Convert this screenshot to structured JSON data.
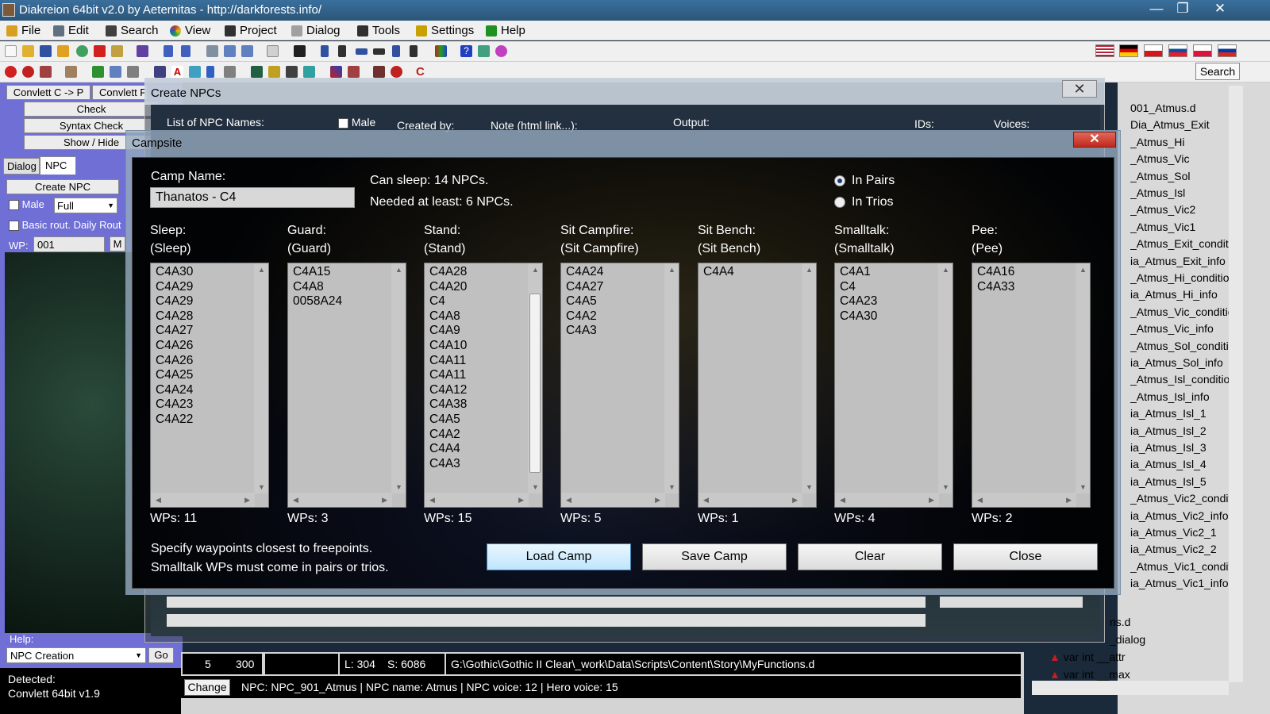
{
  "app": {
    "title": "Diakreion 64bit v2.0 by Aeternitas - http://darkforests.info/",
    "window_controls": {
      "minimize": "—",
      "maximize": "❐",
      "close": "✕"
    }
  },
  "menu": [
    {
      "label": "File",
      "icon": "folder-icon",
      "color": "#d8a020"
    },
    {
      "label": "Edit",
      "icon": "tools-icon",
      "color": "#607080"
    },
    {
      "label": "Search",
      "icon": "search-icon",
      "color": "#404040"
    },
    {
      "label": "View",
      "icon": "color-wheel-icon",
      "color": "#c04020"
    },
    {
      "label": "Project",
      "icon": "project-icon",
      "color": "#303030"
    },
    {
      "label": "Dialog",
      "icon": "dialog-icon",
      "color": "#a0a0a0"
    },
    {
      "label": "Tools",
      "icon": "flask-icon",
      "color": "#303030"
    },
    {
      "label": "Settings",
      "icon": "settings-icon",
      "color": "#c8a000"
    },
    {
      "label": "Help",
      "icon": "help-icon",
      "color": "#209020"
    }
  ],
  "toolbar": {
    "search_label": "Search"
  },
  "left": {
    "convlett_cp": "Convlett C -> P",
    "convlett_2": "Convlett F",
    "check": "Check",
    "syntax_check": "Syntax Check",
    "show_hide": "Show / Hide",
    "tabs": [
      "Dialog",
      "NPC"
    ],
    "create_npc": "Create NPC",
    "male_label": "Male",
    "full_value": "Full",
    "basic_rout": "Basic rout. Daily Rout",
    "wp_label": "WP:",
    "wp_value": "001",
    "wp_btn": "M",
    "help_label": "Help:",
    "help_value": "NPC Creation",
    "go": "Go",
    "detected_label": "Detected:",
    "detected_value": "Convlett 64bit v1.9"
  },
  "create_npcs": {
    "title": "Create NPCs",
    "list_label": "List of NPC Names:",
    "male": "Male",
    "created_by": "Created by:",
    "note": "Note (html link...):",
    "output": "Output:",
    "ids": "IDs:",
    "voices": "Voices:"
  },
  "campsite": {
    "title": "Campsite",
    "camp_name_label": "Camp Name:",
    "camp_name_value": "Thanatos - C4",
    "can_sleep": "Can sleep: 14 NPCs.",
    "needed": "Needed at least: 6 NPCs.",
    "radio_pairs": "In Pairs",
    "radio_trios": "In Trios",
    "columns": [
      {
        "label": "Sleep:",
        "sub": "(Sleep)",
        "items": [
          "C4A30",
          "C4A29",
          "C4A29",
          "C4A28",
          "C4A27",
          "C4A26",
          "C4A26",
          "C4A25",
          "C4A24",
          "C4A23",
          "C4A22"
        ],
        "wps": "WPs: 11"
      },
      {
        "label": "Guard:",
        "sub": "(Guard)",
        "items": [
          "C4A15",
          "C4A8",
          "0058A24"
        ],
        "wps": "WPs: 3"
      },
      {
        "label": "Stand:",
        "sub": "(Stand)",
        "items": [
          "C4A28",
          "C4A20",
          "C4",
          "C4A8",
          "C4A9",
          "C4A10",
          "C4A11",
          "C4A11",
          "C4A12",
          "C4A38",
          "C4A5",
          "C4A2",
          "C4A4",
          "C4A3"
        ],
        "wps": "WPs: 15"
      },
      {
        "label": "Sit Campfire:",
        "sub": "(Sit Campfire)",
        "items": [
          "C4A24",
          "C4A27",
          "C4A5",
          "C4A2",
          "C4A3"
        ],
        "wps": "WPs: 5"
      },
      {
        "label": "Sit Bench:",
        "sub": "(Sit Bench)",
        "items": [
          "C4A4"
        ],
        "wps": "WPs: 1"
      },
      {
        "label": "Smalltalk:",
        "sub": "(Smalltalk)",
        "items": [
          "C4A1",
          "C4",
          "C4A23",
          "C4A30"
        ],
        "wps": "WPs: 4"
      },
      {
        "label": "Pee:",
        "sub": "(Pee)",
        "items": [
          "C4A16",
          "C4A33"
        ],
        "wps": "WPs: 2"
      }
    ],
    "hint1": "Specify waypoints closest to freepoints.",
    "hint2": "Smalltalk WPs must come in pairs or trios.",
    "buttons": {
      "load": "Load Camp",
      "save": "Save Camp",
      "clear": "Clear",
      "close": "Close"
    }
  },
  "right": {
    "files": [
      "001_Atmus.d",
      "Dia_Atmus_Exit",
      "_Atmus_Hi",
      "_Atmus_Vic",
      "_Atmus_Sol",
      "_Atmus_Isl",
      "_Atmus_Vic2",
      "_Atmus_Vic1",
      "_Atmus_Exit_conditi",
      "ia_Atmus_Exit_info",
      "_Atmus_Hi_conditio",
      "ia_Atmus_Hi_info",
      "_Atmus_Vic_conditic",
      "_Atmus_Vic_info",
      "_Atmus_Sol_conditi",
      "ia_Atmus_Sol_info",
      "_Atmus_Isl_conditio",
      "_Atmus_Isl_info",
      "ia_Atmus_Isl_1",
      "ia_Atmus_Isl_2",
      "ia_Atmus_Isl_3",
      "ia_Atmus_Isl_4",
      "ia_Atmus_Isl_5",
      "_Atmus_Vic2_condit",
      "ia_Atmus_Vic2_info",
      "ia_Atmus_Vic2_1",
      "ia_Atmus_Vic2_2",
      "_Atmus_Vic1_condit",
      "ia_Atmus_Vic1_info"
    ],
    "bottom": [
      "ns.d",
      "_dialog",
      "var int __attr",
      "var int __max"
    ]
  },
  "status": {
    "num1": "5",
    "num2": "300",
    "line": "L: 304",
    "sel": "S: 6086",
    "path": "G:\\Gothic\\Gothic II Clear\\_work\\Data\\Scripts\\Content\\Story\\MyFunctions.d",
    "change": "Change",
    "npc_info": "NPC: NPC_901_Atmus  |  NPC name: Atmus  |  NPC voice: 12  |  Hero voice: 15"
  }
}
